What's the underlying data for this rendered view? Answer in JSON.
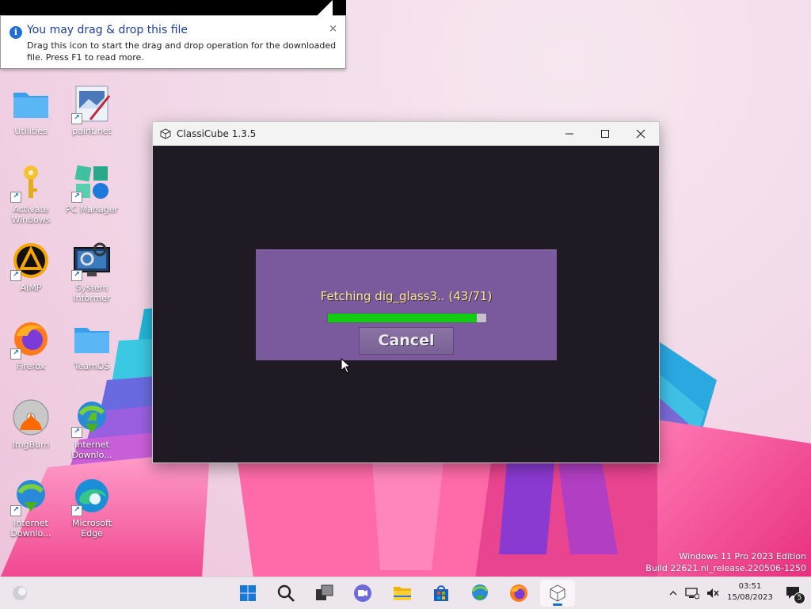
{
  "tooltip": {
    "title": "You may drag & drop this file",
    "body": "Drag this icon to start the drag and drop operation for the downloaded file. Press F1 to read more.",
    "close": "×"
  },
  "desktop_icons": [
    {
      "label": "Utilities",
      "icon": "folder-icon"
    },
    {
      "label": "paint.net",
      "icon": "paintnet-icon"
    },
    {
      "label": "Activate Windows",
      "icon": "key-icon"
    },
    {
      "label": "PC Manager",
      "icon": "pc-manager-icon"
    },
    {
      "label": "AIMP",
      "icon": "aimp-icon"
    },
    {
      "label": "System Informer",
      "icon": "system-informer-icon"
    },
    {
      "label": "Firefox",
      "icon": "firefox-icon"
    },
    {
      "label": "TeamOS",
      "icon": "folder-icon"
    },
    {
      "label": "ImgBurn",
      "icon": "imgburn-icon"
    },
    {
      "label": "Internet Downlo...",
      "icon": "idm-icon"
    },
    {
      "label": "Internet Downlo...",
      "icon": "idm-icon"
    },
    {
      "label": "Microsoft Edge",
      "icon": "edge-icon"
    }
  ],
  "window": {
    "title": "ClassiCube 1.3.5",
    "minimize": "—",
    "maximize": "☐",
    "close": "✕"
  },
  "dialog": {
    "status_text": "Fetching dig_glass3.. (43/71)",
    "progress_percent": 94,
    "cancel_label": "Cancel"
  },
  "watermark": {
    "line1": "Windows 11 Pro 2023 Edition",
    "line2": "Build 22621.ni_release.220506-1250"
  },
  "taskbar": {
    "time": "03:51",
    "date": "15/08/2023",
    "notification_count": "5"
  },
  "colors": {
    "dialog_bg": "#7a5a9c",
    "progress_fill": "#12cc12",
    "status_text": "#ffea8a",
    "client_bg": "#1f1a24"
  }
}
